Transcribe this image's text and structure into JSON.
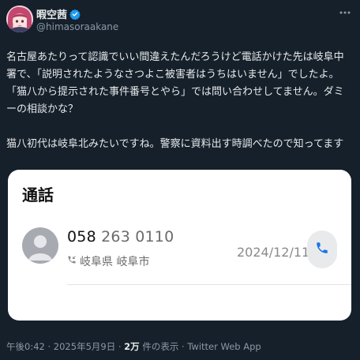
{
  "author": {
    "display_name": "暇空茜",
    "handle": "@himasoraakane",
    "verified_icon": "verified-badge-icon",
    "more_icon": "more-options-icon"
  },
  "tweet": {
    "paragraph1": "名古屋あたりって認識でいい間違えたんだろうけど電話かけた先は岐阜中署で、「説明されたようなさつよこ被害者はうちはいません」でしたよ。「猫八から提示された事件番号とやら」では問い合わせしてません。ダミーの相談かな？",
    "paragraph2": "猫八初代は岐阜北みたいですね。警察に資料出す時調べたので知ってます"
  },
  "media": {
    "title": "通話",
    "phone_prefix": "058",
    "phone_rest": "263 0110",
    "location": "岐阜県 岐阜市",
    "date": "2024/12/11",
    "phone_icon": "phone-call-icon",
    "contact_icon": "contact-avatar-icon",
    "incoming_icon": "incoming-call-icon"
  },
  "meta": {
    "time": "午後0:42",
    "sep1": " · ",
    "date": "2025年5月9日",
    "sep2": " · ",
    "views_count": "2万",
    "views_label": " 件の表示",
    "sep3": " · ",
    "source": "Twitter Web App"
  },
  "colors": {
    "background": "#15202b",
    "text": "#e7e9ea",
    "secondary": "#8b98a5",
    "verified": "#1d9bf0",
    "call_blue": "#1a73e8"
  }
}
